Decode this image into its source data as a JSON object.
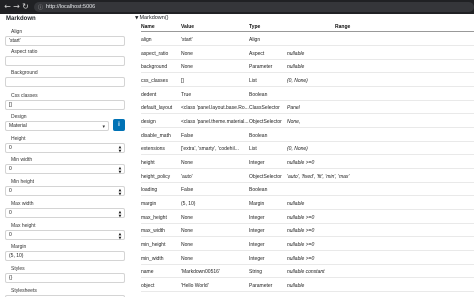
{
  "browser": {
    "url": "http://localhost:5006"
  },
  "panel": {
    "title": "Markdown",
    "fields": [
      {
        "label": "Align",
        "value": "'start'",
        "kind": "text"
      },
      {
        "label": "Aspect ratio",
        "value": "",
        "kind": "text"
      },
      {
        "label": "Background",
        "value": "",
        "kind": "text"
      },
      {
        "label": "Css classes",
        "value": "[]",
        "kind": "text"
      },
      {
        "label": "Design",
        "value": "Material",
        "kind": "select"
      },
      {
        "label": "Height",
        "value": "0",
        "kind": "number"
      },
      {
        "label": "Min width",
        "value": "0",
        "kind": "number"
      },
      {
        "label": "Min height",
        "value": "0",
        "kind": "number"
      },
      {
        "label": "Max width",
        "value": "0",
        "kind": "number"
      },
      {
        "label": "Max height",
        "value": "0",
        "kind": "number"
      },
      {
        "label": "Margin",
        "value": "(5, 10)",
        "kind": "text"
      },
      {
        "label": "Styles",
        "value": "{}",
        "kind": "text"
      },
      {
        "label": "Stylesheets",
        "value": "",
        "kind": "text"
      }
    ],
    "info_button": "i"
  },
  "table": {
    "section": "Markdown()",
    "headers": {
      "name": "Name",
      "value": "Value",
      "type": "Type",
      "range": "Range"
    },
    "rows": [
      {
        "name": "align",
        "value": "'start'",
        "type": "Align",
        "range": ""
      },
      {
        "name": "aspect_ratio",
        "value": "None",
        "type": "Aspect",
        "range": "nullable"
      },
      {
        "name": "background",
        "value": "None",
        "type": "Parameter",
        "range": "nullable"
      },
      {
        "name": "css_classes",
        "value": "[]",
        "type": "List",
        "range": "(0, None)"
      },
      {
        "name": "dedent",
        "value": "True",
        "type": "Boolean",
        "range": ""
      },
      {
        "name": "default_layout",
        "value": "<class 'panel.layout.base.Ro...",
        "type": "ClassSelector",
        "range": "Panel"
      },
      {
        "name": "design",
        "value": "<class 'panel.theme.material....",
        "type": "ObjectSelector",
        "range": "None,"
      },
      {
        "name": "disable_math",
        "value": "False",
        "type": "Boolean",
        "range": ""
      },
      {
        "name": "extensions",
        "value": "['extra', 'smarty', 'codehil...",
        "type": "List",
        "range": "(0, None)"
      },
      {
        "name": "height",
        "value": "None",
        "type": "Integer",
        "range": "nullable >=0"
      },
      {
        "name": "height_policy",
        "value": "'auto'",
        "type": "ObjectSelector",
        "range": "'auto', 'fixed', 'fit', 'min', 'max'"
      },
      {
        "name": "loading",
        "value": "False",
        "type": "Boolean",
        "range": ""
      },
      {
        "name": "margin",
        "value": "(5, 10)",
        "type": "Margin",
        "range": "nullable"
      },
      {
        "name": "max_height",
        "value": "None",
        "type": "Integer",
        "range": "nullable >=0"
      },
      {
        "name": "max_width",
        "value": "None",
        "type": "Integer",
        "range": "nullable >=0"
      },
      {
        "name": "min_height",
        "value": "None",
        "type": "Integer",
        "range": "nullable >=0"
      },
      {
        "name": "min_width",
        "value": "None",
        "type": "Integer",
        "range": "nullable >=0"
      },
      {
        "name": "name",
        "value": "'Markdown00516'",
        "type": "String",
        "range": "nullable constant"
      },
      {
        "name": "object",
        "value": "'Hello World'",
        "type": "Parameter",
        "range": "nullable"
      }
    ]
  },
  "colors": {
    "accent": "#0072b5",
    "chrome": "#202124"
  }
}
